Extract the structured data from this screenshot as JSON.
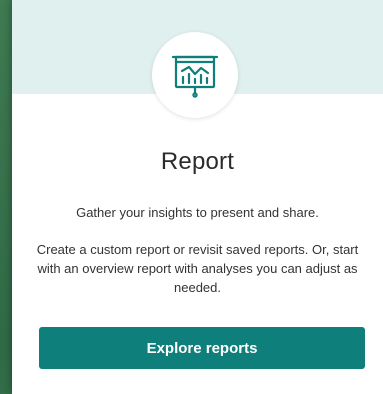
{
  "card": {
    "icon": "presentation-chart-icon",
    "title": "Report",
    "subtitle": "Gather your insights to present and share.",
    "description": "Create a custom report or revisit saved reports. Or, start with an overview report with analyses you can adjust as needed.",
    "cta_label": "Explore reports"
  },
  "colors": {
    "header_bg": "#dff0ef",
    "accent": "#0e7f7b",
    "background": "#3f7a52"
  }
}
